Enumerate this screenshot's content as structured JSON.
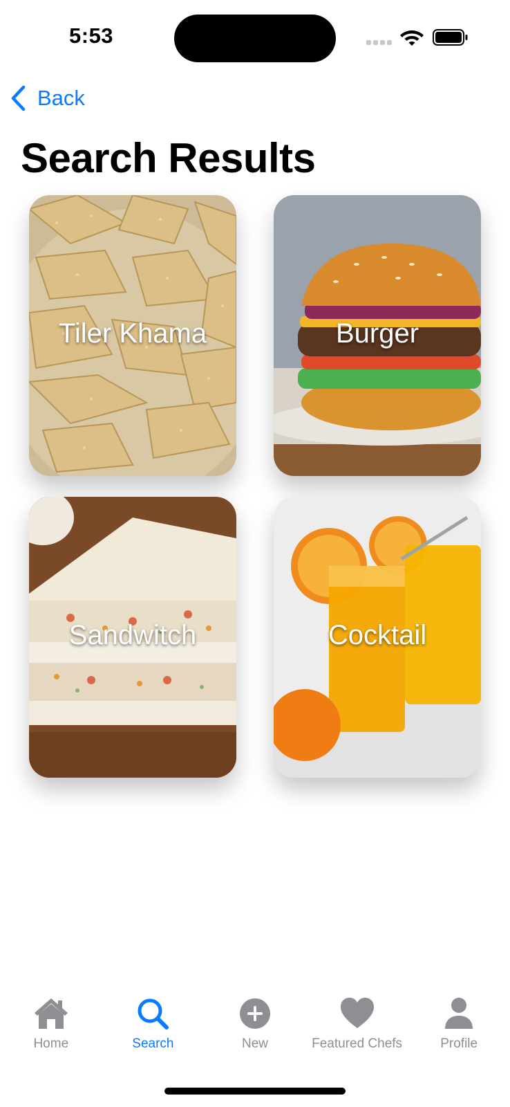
{
  "status_bar": {
    "time": "5:53"
  },
  "nav": {
    "back_label": "Back"
  },
  "page": {
    "title": "Search Results"
  },
  "results": [
    {
      "label": "Tiler Khama",
      "image": "sesame-brittle-photo"
    },
    {
      "label": "Burger",
      "image": "burger-photo"
    },
    {
      "label": "Sandwitch",
      "image": "sandwich-photo"
    },
    {
      "label": "Cocktail",
      "image": "orange-juice-photo"
    }
  ],
  "tab_bar": {
    "items": [
      {
        "label": "Home",
        "icon": "home-icon"
      },
      {
        "label": "Search",
        "icon": "search-icon",
        "active": true
      },
      {
        "label": "New",
        "icon": "plus-circle-icon"
      },
      {
        "label": "Featured Chefs",
        "icon": "heart-icon"
      },
      {
        "label": "Profile",
        "icon": "person-icon"
      }
    ]
  },
  "colors": {
    "accent": "#0a7aff",
    "inactive": "#8e8e93"
  }
}
